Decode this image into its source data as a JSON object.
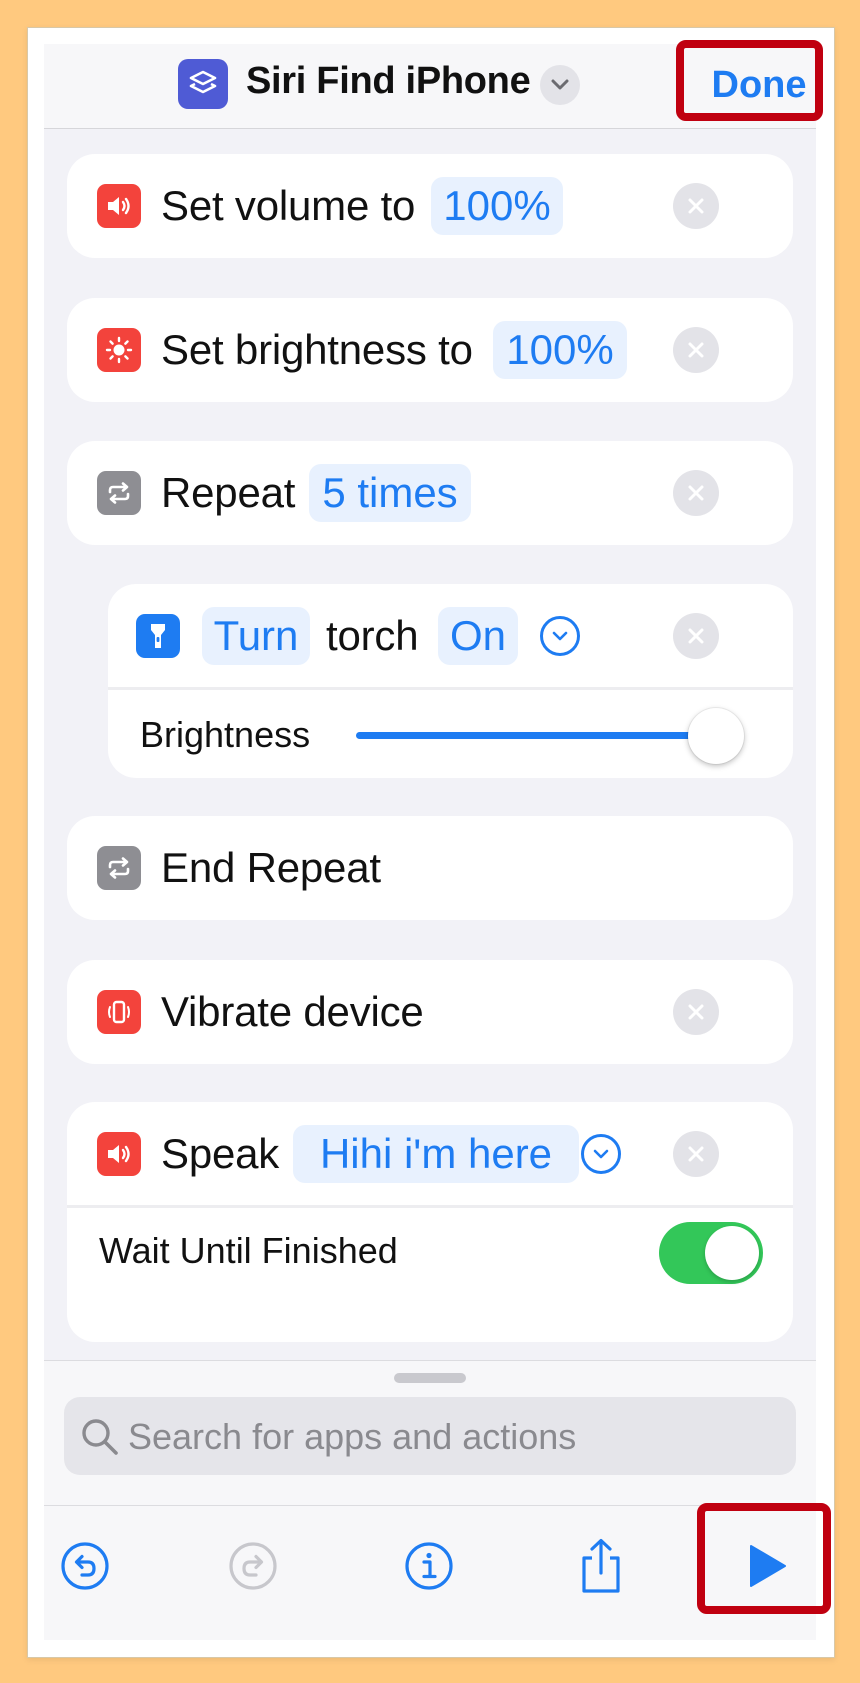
{
  "header": {
    "title": "Siri Find iPhone",
    "done_label": "Done"
  },
  "actions": {
    "volume": {
      "label": "Set volume to",
      "value": "100%"
    },
    "brightness": {
      "label": "Set brightness to",
      "value": "100%"
    },
    "repeat": {
      "label": "Repeat",
      "value": "5 times"
    },
    "torch": {
      "turn": "Turn",
      "label": "torch",
      "state": "On",
      "sub_label": "Brightness",
      "slider_level": 1.0
    },
    "end_repeat": {
      "label": "End Repeat"
    },
    "vibrate": {
      "label": "Vibrate device"
    },
    "speak": {
      "label": "Speak",
      "value": "Hihi i'm here",
      "sub_label": "Wait Until Finished",
      "toggle_on": true
    }
  },
  "search": {
    "placeholder": "Search for apps and actions"
  },
  "toolbar": {
    "icons": [
      "undo-icon",
      "redo-icon",
      "info-icon",
      "share-icon",
      "play-icon"
    ]
  },
  "colors": {
    "accent": "#1E7CF2",
    "highlight": "#C00010",
    "background": "#FFC97F",
    "toggle_on": "#33C759"
  }
}
